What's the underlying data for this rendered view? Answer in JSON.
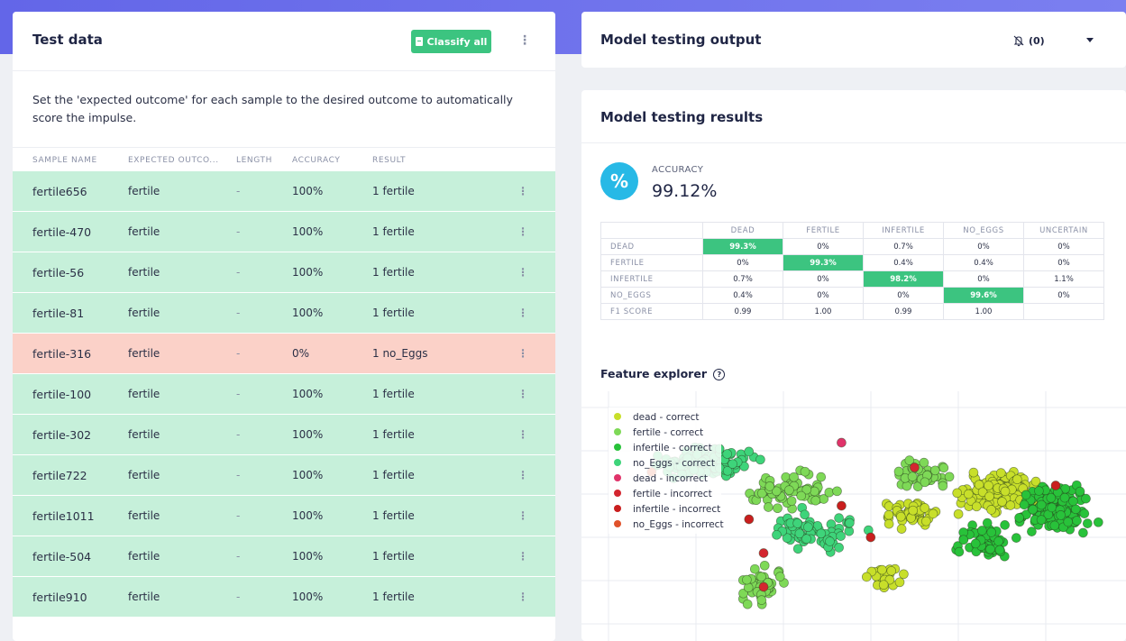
{
  "test_data": {
    "title": "Test data",
    "classify_all_label": "Classify all",
    "description": "Set the 'expected outcome' for each sample to the desired outcome to automatically score the impulse.",
    "columns": [
      "SAMPLE NAME",
      "EXPECTED OUTCO...",
      "LENGTH",
      "ACCURACY",
      "RESULT"
    ],
    "rows": [
      {
        "name": "fertile656",
        "expected": "fertile",
        "length": "-",
        "accuracy": "100%",
        "result": "1 fertile",
        "status": "correct"
      },
      {
        "name": "fertile-470",
        "expected": "fertile",
        "length": "-",
        "accuracy": "100%",
        "result": "1 fertile",
        "status": "correct"
      },
      {
        "name": "fertile-56",
        "expected": "fertile",
        "length": "-",
        "accuracy": "100%",
        "result": "1 fertile",
        "status": "correct"
      },
      {
        "name": "fertile-81",
        "expected": "fertile",
        "length": "-",
        "accuracy": "100%",
        "result": "1 fertile",
        "status": "correct"
      },
      {
        "name": "fertile-316",
        "expected": "fertile",
        "length": "-",
        "accuracy": "0%",
        "result": "1 no_Eggs",
        "status": "incorrect"
      },
      {
        "name": "fertile-100",
        "expected": "fertile",
        "length": "-",
        "accuracy": "100%",
        "result": "1 fertile",
        "status": "correct"
      },
      {
        "name": "fertile-302",
        "expected": "fertile",
        "length": "-",
        "accuracy": "100%",
        "result": "1 fertile",
        "status": "correct"
      },
      {
        "name": "fertile722",
        "expected": "fertile",
        "length": "-",
        "accuracy": "100%",
        "result": "1 fertile",
        "status": "correct"
      },
      {
        "name": "fertile1011",
        "expected": "fertile",
        "length": "-",
        "accuracy": "100%",
        "result": "1 fertile",
        "status": "correct"
      },
      {
        "name": "fertile-504",
        "expected": "fertile",
        "length": "-",
        "accuracy": "100%",
        "result": "1 fertile",
        "status": "correct"
      },
      {
        "name": "fertile910",
        "expected": "fertile",
        "length": "-",
        "accuracy": "100%",
        "result": "1 fertile",
        "status": "correct"
      }
    ]
  },
  "model_output": {
    "title": "Model testing output",
    "notifications_label": "(0)"
  },
  "results": {
    "title": "Model testing results",
    "accuracy_label": "ACCURACY",
    "accuracy_value": "99.12%",
    "percent_symbol": "%",
    "matrix": {
      "columns": [
        "DEAD",
        "FERTILE",
        "INFERTILE",
        "NO_EGGS",
        "UNCERTAIN"
      ],
      "rows": [
        {
          "label": "DEAD",
          "cells": [
            "99.3%",
            "0%",
            "0.7%",
            "0%",
            "0%"
          ]
        },
        {
          "label": "FERTILE",
          "cells": [
            "0%",
            "99.3%",
            "0.4%",
            "0.4%",
            "0%"
          ]
        },
        {
          "label": "INFERTILE",
          "cells": [
            "0.7%",
            "0%",
            "98.2%",
            "0%",
            "1.1%"
          ]
        },
        {
          "label": "NO_EGGS",
          "cells": [
            "0.4%",
            "0%",
            "0%",
            "99.6%",
            "0%"
          ]
        },
        {
          "label": "F1 SCORE",
          "cells": [
            "0.99",
            "1.00",
            "0.99",
            "1.00",
            ""
          ]
        }
      ]
    },
    "feature_explorer_title": "Feature explorer",
    "help_glyph": "?"
  },
  "chart_data": {
    "type": "scatter",
    "title": "",
    "grid": true,
    "legend_position": "top-left",
    "legend": [
      {
        "name": "dead - correct",
        "color": "#c8df2a"
      },
      {
        "name": "fertile - correct",
        "color": "#7ed957"
      },
      {
        "name": "infertile - correct",
        "color": "#28c23a"
      },
      {
        "name": "no_Eggs - correct",
        "color": "#3ed47a"
      },
      {
        "name": "dead - incorrect",
        "color": "#e0336a"
      },
      {
        "name": "fertile - incorrect",
        "color": "#d3262f"
      },
      {
        "name": "infertile - incorrect",
        "color": "#c91e1e"
      },
      {
        "name": "no_Eggs - incorrect",
        "color": "#e0522b"
      }
    ],
    "series": [
      {
        "name": "dead - correct",
        "clusters": [
          [
            0.78,
            0.62,
            0.06,
            0.07,
            160
          ],
          [
            0.6,
            0.52,
            0.05,
            0.05,
            50
          ],
          [
            0.55,
            0.25,
            0.03,
            0.05,
            30
          ]
        ]
      },
      {
        "name": "fertile - correct",
        "clusters": [
          [
            0.35,
            0.62,
            0.08,
            0.07,
            70
          ],
          [
            0.62,
            0.7,
            0.05,
            0.05,
            40
          ],
          [
            0.3,
            0.2,
            0.04,
            0.07,
            45
          ]
        ]
      },
      {
        "name": "infertile - correct",
        "clusters": [
          [
            0.9,
            0.55,
            0.06,
            0.09,
            160
          ],
          [
            0.75,
            0.4,
            0.05,
            0.06,
            60
          ]
        ]
      },
      {
        "name": "no_Eggs - correct",
        "clusters": [
          [
            0.18,
            0.75,
            0.09,
            0.06,
            130
          ],
          [
            0.4,
            0.45,
            0.08,
            0.07,
            70
          ]
        ]
      },
      {
        "name": "dead - incorrect",
        "points": [
          [
            0.46,
            0.84
          ]
        ]
      },
      {
        "name": "fertile - incorrect",
        "points": [
          [
            0.3,
            0.2
          ],
          [
            0.3,
            0.35
          ],
          [
            0.61,
            0.73
          ]
        ]
      },
      {
        "name": "infertile - incorrect",
        "points": [
          [
            0.52,
            0.42
          ],
          [
            0.9,
            0.65
          ],
          [
            0.46,
            0.56
          ],
          [
            0.27,
            0.5
          ]
        ]
      },
      {
        "name": "no_Eggs - incorrect",
        "points": [
          [
            0.07,
            0.71
          ]
        ]
      }
    ]
  }
}
